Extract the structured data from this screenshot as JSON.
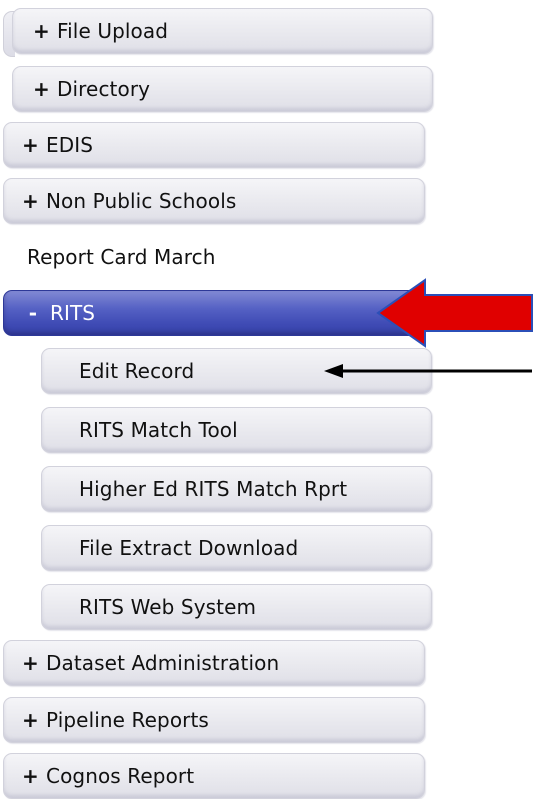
{
  "menu": {
    "items": [
      {
        "toggle": "+",
        "label": "File Upload"
      },
      {
        "toggle": "+",
        "label": "Directory"
      },
      {
        "toggle": "+",
        "label": "EDIS"
      },
      {
        "toggle": "+",
        "label": "Non Public Schools"
      },
      {
        "label": "Report Card March"
      },
      {
        "toggle": "-",
        "label": "RITS"
      },
      {
        "label": "Dataset Administration",
        "toggle": "+"
      },
      {
        "label": "Pipeline Reports",
        "toggle": "+"
      },
      {
        "label": "Cognos Report",
        "toggle": "+"
      }
    ],
    "rits_children": [
      {
        "label": "Edit Record"
      },
      {
        "label": "RITS Match Tool"
      },
      {
        "label": "Higher Ed RITS Match Rprt"
      },
      {
        "label": "File Extract Download"
      },
      {
        "label": "RITS Web System"
      }
    ]
  },
  "colors": {
    "expanded_bg": "#4450b8",
    "annotation_red": "#e00000",
    "annotation_black": "#000000"
  }
}
